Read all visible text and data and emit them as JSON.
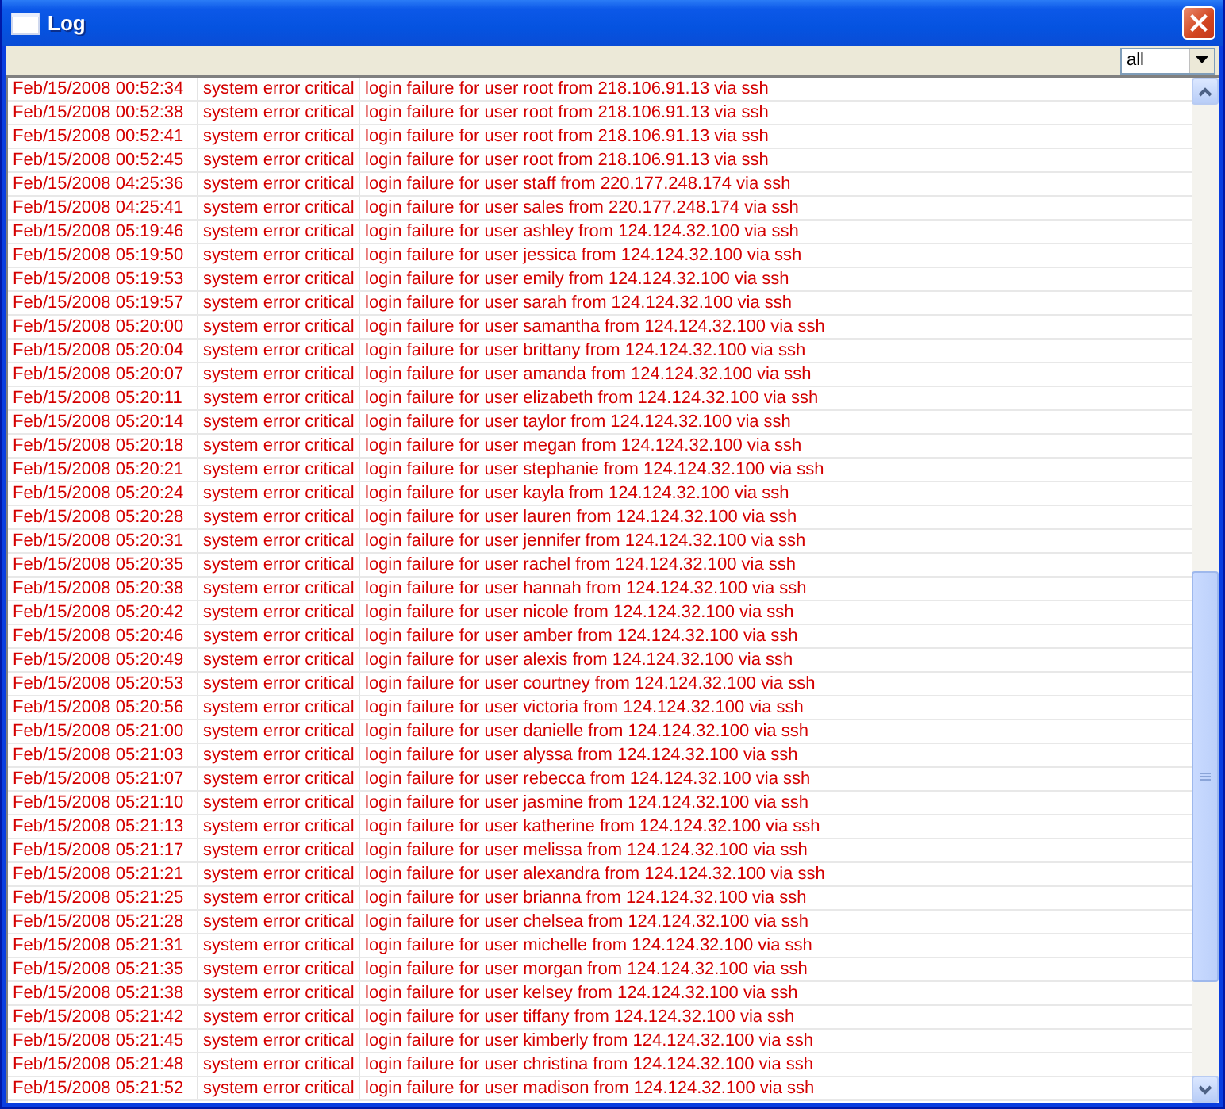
{
  "window": {
    "title": "Log"
  },
  "filter": {
    "value": "all"
  },
  "rows": [
    {
      "time": "Feb/15/2008 00:52:34",
      "source": "system error critical",
      "message": "login failure for user root from 218.106.91.13 via ssh"
    },
    {
      "time": "Feb/15/2008 00:52:38",
      "source": "system error critical",
      "message": "login failure for user root from 218.106.91.13 via ssh"
    },
    {
      "time": "Feb/15/2008 00:52:41",
      "source": "system error critical",
      "message": "login failure for user root from 218.106.91.13 via ssh"
    },
    {
      "time": "Feb/15/2008 00:52:45",
      "source": "system error critical",
      "message": "login failure for user root from 218.106.91.13 via ssh"
    },
    {
      "time": "Feb/15/2008 04:25:36",
      "source": "system error critical",
      "message": "login failure for user staff from 220.177.248.174 via ssh"
    },
    {
      "time": "Feb/15/2008 04:25:41",
      "source": "system error critical",
      "message": "login failure for user sales from 220.177.248.174 via ssh"
    },
    {
      "time": "Feb/15/2008 05:19:46",
      "source": "system error critical",
      "message": "login failure for user ashley from 124.124.32.100 via ssh"
    },
    {
      "time": "Feb/15/2008 05:19:50",
      "source": "system error critical",
      "message": "login failure for user jessica from 124.124.32.100 via ssh"
    },
    {
      "time": "Feb/15/2008 05:19:53",
      "source": "system error critical",
      "message": "login failure for user emily from 124.124.32.100 via ssh"
    },
    {
      "time": "Feb/15/2008 05:19:57",
      "source": "system error critical",
      "message": "login failure for user sarah from 124.124.32.100 via ssh"
    },
    {
      "time": "Feb/15/2008 05:20:00",
      "source": "system error critical",
      "message": "login failure for user samantha from 124.124.32.100 via ssh"
    },
    {
      "time": "Feb/15/2008 05:20:04",
      "source": "system error critical",
      "message": "login failure for user brittany from 124.124.32.100 via ssh"
    },
    {
      "time": "Feb/15/2008 05:20:07",
      "source": "system error critical",
      "message": "login failure for user amanda from 124.124.32.100 via ssh"
    },
    {
      "time": "Feb/15/2008 05:20:11",
      "source": "system error critical",
      "message": "login failure for user elizabeth from 124.124.32.100 via ssh"
    },
    {
      "time": "Feb/15/2008 05:20:14",
      "source": "system error critical",
      "message": "login failure for user taylor from 124.124.32.100 via ssh"
    },
    {
      "time": "Feb/15/2008 05:20:18",
      "source": "system error critical",
      "message": "login failure for user megan from 124.124.32.100 via ssh"
    },
    {
      "time": "Feb/15/2008 05:20:21",
      "source": "system error critical",
      "message": "login failure for user stephanie from 124.124.32.100 via ssh"
    },
    {
      "time": "Feb/15/2008 05:20:24",
      "source": "system error critical",
      "message": "login failure for user kayla from 124.124.32.100 via ssh"
    },
    {
      "time": "Feb/15/2008 05:20:28",
      "source": "system error critical",
      "message": "login failure for user lauren from 124.124.32.100 via ssh"
    },
    {
      "time": "Feb/15/2008 05:20:31",
      "source": "system error critical",
      "message": "login failure for user jennifer from 124.124.32.100 via ssh"
    },
    {
      "time": "Feb/15/2008 05:20:35",
      "source": "system error critical",
      "message": "login failure for user rachel from 124.124.32.100 via ssh"
    },
    {
      "time": "Feb/15/2008 05:20:38",
      "source": "system error critical",
      "message": "login failure for user hannah from 124.124.32.100 via ssh"
    },
    {
      "time": "Feb/15/2008 05:20:42",
      "source": "system error critical",
      "message": "login failure for user nicole from 124.124.32.100 via ssh"
    },
    {
      "time": "Feb/15/2008 05:20:46",
      "source": "system error critical",
      "message": "login failure for user amber from 124.124.32.100 via ssh"
    },
    {
      "time": "Feb/15/2008 05:20:49",
      "source": "system error critical",
      "message": "login failure for user alexis from 124.124.32.100 via ssh"
    },
    {
      "time": "Feb/15/2008 05:20:53",
      "source": "system error critical",
      "message": "login failure for user courtney from 124.124.32.100 via ssh"
    },
    {
      "time": "Feb/15/2008 05:20:56",
      "source": "system error critical",
      "message": "login failure for user victoria from 124.124.32.100 via ssh"
    },
    {
      "time": "Feb/15/2008 05:21:00",
      "source": "system error critical",
      "message": "login failure for user danielle from 124.124.32.100 via ssh"
    },
    {
      "time": "Feb/15/2008 05:21:03",
      "source": "system error critical",
      "message": "login failure for user alyssa from 124.124.32.100 via ssh"
    },
    {
      "time": "Feb/15/2008 05:21:07",
      "source": "system error critical",
      "message": "login failure for user rebecca from 124.124.32.100 via ssh"
    },
    {
      "time": "Feb/15/2008 05:21:10",
      "source": "system error critical",
      "message": "login failure for user jasmine from 124.124.32.100 via ssh"
    },
    {
      "time": "Feb/15/2008 05:21:13",
      "source": "system error critical",
      "message": "login failure for user katherine from 124.124.32.100 via ssh"
    },
    {
      "time": "Feb/15/2008 05:21:17",
      "source": "system error critical",
      "message": "login failure for user melissa from 124.124.32.100 via ssh"
    },
    {
      "time": "Feb/15/2008 05:21:21",
      "source": "system error critical",
      "message": "login failure for user alexandra from 124.124.32.100 via ssh"
    },
    {
      "time": "Feb/15/2008 05:21:25",
      "source": "system error critical",
      "message": "login failure for user brianna from 124.124.32.100 via ssh"
    },
    {
      "time": "Feb/15/2008 05:21:28",
      "source": "system error critical",
      "message": "login failure for user chelsea from 124.124.32.100 via ssh"
    },
    {
      "time": "Feb/15/2008 05:21:31",
      "source": "system error critical",
      "message": "login failure for user michelle from 124.124.32.100 via ssh"
    },
    {
      "time": "Feb/15/2008 05:21:35",
      "source": "system error critical",
      "message": "login failure for user morgan from 124.124.32.100 via ssh"
    },
    {
      "time": "Feb/15/2008 05:21:38",
      "source": "system error critical",
      "message": "login failure for user kelsey from 124.124.32.100 via ssh"
    },
    {
      "time": "Feb/15/2008 05:21:42",
      "source": "system error critical",
      "message": "login failure for user tiffany from 124.124.32.100 via ssh"
    },
    {
      "time": "Feb/15/2008 05:21:45",
      "source": "system error critical",
      "message": "login failure for user kimberly from 124.124.32.100 via ssh"
    },
    {
      "time": "Feb/15/2008 05:21:48",
      "source": "system error critical",
      "message": "login failure for user christina from 124.124.32.100 via ssh"
    },
    {
      "time": "Feb/15/2008 05:21:52",
      "source": "system error critical",
      "message": "login failure for user madison from 124.124.32.100 via ssh"
    }
  ]
}
